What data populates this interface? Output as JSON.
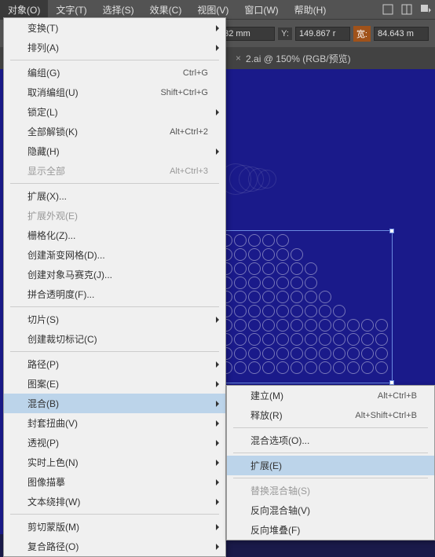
{
  "menubar": {
    "items": [
      {
        "label": "对象(O)",
        "active": true
      },
      {
        "label": "文字(T)"
      },
      {
        "label": "选择(S)"
      },
      {
        "label": "效果(C)"
      },
      {
        "label": "视图(V)"
      },
      {
        "label": "窗口(W)"
      },
      {
        "label": "帮助(H)"
      }
    ]
  },
  "toolbar": {
    "x_suffix": "32 mm",
    "y_label": "Y:",
    "y_value": "149.867 r",
    "w_label": "宽:",
    "w_value": "84.643 m"
  },
  "tab": {
    "label": "2.ai @ 150% (RGB/预览)"
  },
  "menu": [
    {
      "label": "变换(T)",
      "sub": true
    },
    {
      "label": "排列(A)",
      "sub": true
    },
    {
      "sep": true
    },
    {
      "label": "编组(G)",
      "shortcut": "Ctrl+G"
    },
    {
      "label": "取消编组(U)",
      "shortcut": "Shift+Ctrl+G"
    },
    {
      "label": "锁定(L)",
      "sub": true
    },
    {
      "label": "全部解锁(K)",
      "shortcut": "Alt+Ctrl+2"
    },
    {
      "label": "隐藏(H)",
      "sub": true
    },
    {
      "label": "显示全部",
      "shortcut": "Alt+Ctrl+3",
      "disabled": true
    },
    {
      "sep": true
    },
    {
      "label": "扩展(X)..."
    },
    {
      "label": "扩展外观(E)",
      "disabled": true
    },
    {
      "label": "栅格化(Z)..."
    },
    {
      "label": "创建渐变网格(D)..."
    },
    {
      "label": "创建对象马赛克(J)..."
    },
    {
      "label": "拼合透明度(F)..."
    },
    {
      "sep": true
    },
    {
      "label": "切片(S)",
      "sub": true
    },
    {
      "label": "创建裁切标记(C)"
    },
    {
      "sep": true
    },
    {
      "label": "路径(P)",
      "sub": true
    },
    {
      "label": "图案(E)",
      "sub": true
    },
    {
      "label": "混合(B)",
      "sub": true,
      "highlight": true
    },
    {
      "label": "封套扭曲(V)",
      "sub": true
    },
    {
      "label": "透视(P)",
      "sub": true
    },
    {
      "label": "实时上色(N)",
      "sub": true
    },
    {
      "label": "图像描摹",
      "sub": true
    },
    {
      "label": "文本绕排(W)",
      "sub": true
    },
    {
      "sep": true
    },
    {
      "label": "剪切蒙版(M)",
      "sub": true
    },
    {
      "label": "复合路径(O)",
      "sub": true
    }
  ],
  "submenu": [
    {
      "label": "建立(M)",
      "shortcut": "Alt+Ctrl+B"
    },
    {
      "label": "释放(R)",
      "shortcut": "Alt+Shift+Ctrl+B"
    },
    {
      "sep": true
    },
    {
      "label": "混合选项(O)..."
    },
    {
      "sep": true
    },
    {
      "label": "扩展(E)",
      "highlight": true
    },
    {
      "sep": true
    },
    {
      "label": "替换混合轴(S)",
      "disabled": true
    },
    {
      "label": "反向混合轴(V)"
    },
    {
      "label": "反向堆叠(F)"
    }
  ]
}
